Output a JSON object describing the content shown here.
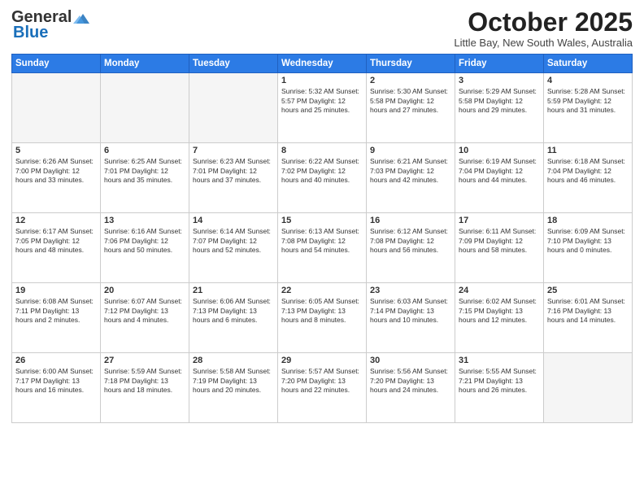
{
  "logo": {
    "general": "General",
    "blue": "Blue"
  },
  "title": "October 2025",
  "location": "Little Bay, New South Wales, Australia",
  "headers": [
    "Sunday",
    "Monday",
    "Tuesday",
    "Wednesday",
    "Thursday",
    "Friday",
    "Saturday"
  ],
  "weeks": [
    [
      {
        "day": "",
        "detail": ""
      },
      {
        "day": "",
        "detail": ""
      },
      {
        "day": "",
        "detail": ""
      },
      {
        "day": "1",
        "detail": "Sunrise: 5:32 AM\nSunset: 5:57 PM\nDaylight: 12 hours\nand 25 minutes."
      },
      {
        "day": "2",
        "detail": "Sunrise: 5:30 AM\nSunset: 5:58 PM\nDaylight: 12 hours\nand 27 minutes."
      },
      {
        "day": "3",
        "detail": "Sunrise: 5:29 AM\nSunset: 5:58 PM\nDaylight: 12 hours\nand 29 minutes."
      },
      {
        "day": "4",
        "detail": "Sunrise: 5:28 AM\nSunset: 5:59 PM\nDaylight: 12 hours\nand 31 minutes."
      }
    ],
    [
      {
        "day": "5",
        "detail": "Sunrise: 6:26 AM\nSunset: 7:00 PM\nDaylight: 12 hours\nand 33 minutes."
      },
      {
        "day": "6",
        "detail": "Sunrise: 6:25 AM\nSunset: 7:01 PM\nDaylight: 12 hours\nand 35 minutes."
      },
      {
        "day": "7",
        "detail": "Sunrise: 6:23 AM\nSunset: 7:01 PM\nDaylight: 12 hours\nand 37 minutes."
      },
      {
        "day": "8",
        "detail": "Sunrise: 6:22 AM\nSunset: 7:02 PM\nDaylight: 12 hours\nand 40 minutes."
      },
      {
        "day": "9",
        "detail": "Sunrise: 6:21 AM\nSunset: 7:03 PM\nDaylight: 12 hours\nand 42 minutes."
      },
      {
        "day": "10",
        "detail": "Sunrise: 6:19 AM\nSunset: 7:04 PM\nDaylight: 12 hours\nand 44 minutes."
      },
      {
        "day": "11",
        "detail": "Sunrise: 6:18 AM\nSunset: 7:04 PM\nDaylight: 12 hours\nand 46 minutes."
      }
    ],
    [
      {
        "day": "12",
        "detail": "Sunrise: 6:17 AM\nSunset: 7:05 PM\nDaylight: 12 hours\nand 48 minutes."
      },
      {
        "day": "13",
        "detail": "Sunrise: 6:16 AM\nSunset: 7:06 PM\nDaylight: 12 hours\nand 50 minutes."
      },
      {
        "day": "14",
        "detail": "Sunrise: 6:14 AM\nSunset: 7:07 PM\nDaylight: 12 hours\nand 52 minutes."
      },
      {
        "day": "15",
        "detail": "Sunrise: 6:13 AM\nSunset: 7:08 PM\nDaylight: 12 hours\nand 54 minutes."
      },
      {
        "day": "16",
        "detail": "Sunrise: 6:12 AM\nSunset: 7:08 PM\nDaylight: 12 hours\nand 56 minutes."
      },
      {
        "day": "17",
        "detail": "Sunrise: 6:11 AM\nSunset: 7:09 PM\nDaylight: 12 hours\nand 58 minutes."
      },
      {
        "day": "18",
        "detail": "Sunrise: 6:09 AM\nSunset: 7:10 PM\nDaylight: 13 hours\nand 0 minutes."
      }
    ],
    [
      {
        "day": "19",
        "detail": "Sunrise: 6:08 AM\nSunset: 7:11 PM\nDaylight: 13 hours\nand 2 minutes."
      },
      {
        "day": "20",
        "detail": "Sunrise: 6:07 AM\nSunset: 7:12 PM\nDaylight: 13 hours\nand 4 minutes."
      },
      {
        "day": "21",
        "detail": "Sunrise: 6:06 AM\nSunset: 7:13 PM\nDaylight: 13 hours\nand 6 minutes."
      },
      {
        "day": "22",
        "detail": "Sunrise: 6:05 AM\nSunset: 7:13 PM\nDaylight: 13 hours\nand 8 minutes."
      },
      {
        "day": "23",
        "detail": "Sunrise: 6:03 AM\nSunset: 7:14 PM\nDaylight: 13 hours\nand 10 minutes."
      },
      {
        "day": "24",
        "detail": "Sunrise: 6:02 AM\nSunset: 7:15 PM\nDaylight: 13 hours\nand 12 minutes."
      },
      {
        "day": "25",
        "detail": "Sunrise: 6:01 AM\nSunset: 7:16 PM\nDaylight: 13 hours\nand 14 minutes."
      }
    ],
    [
      {
        "day": "26",
        "detail": "Sunrise: 6:00 AM\nSunset: 7:17 PM\nDaylight: 13 hours\nand 16 minutes."
      },
      {
        "day": "27",
        "detail": "Sunrise: 5:59 AM\nSunset: 7:18 PM\nDaylight: 13 hours\nand 18 minutes."
      },
      {
        "day": "28",
        "detail": "Sunrise: 5:58 AM\nSunset: 7:19 PM\nDaylight: 13 hours\nand 20 minutes."
      },
      {
        "day": "29",
        "detail": "Sunrise: 5:57 AM\nSunset: 7:20 PM\nDaylight: 13 hours\nand 22 minutes."
      },
      {
        "day": "30",
        "detail": "Sunrise: 5:56 AM\nSunset: 7:20 PM\nDaylight: 13 hours\nand 24 minutes."
      },
      {
        "day": "31",
        "detail": "Sunrise: 5:55 AM\nSunset: 7:21 PM\nDaylight: 13 hours\nand 26 minutes."
      },
      {
        "day": "",
        "detail": ""
      }
    ]
  ]
}
